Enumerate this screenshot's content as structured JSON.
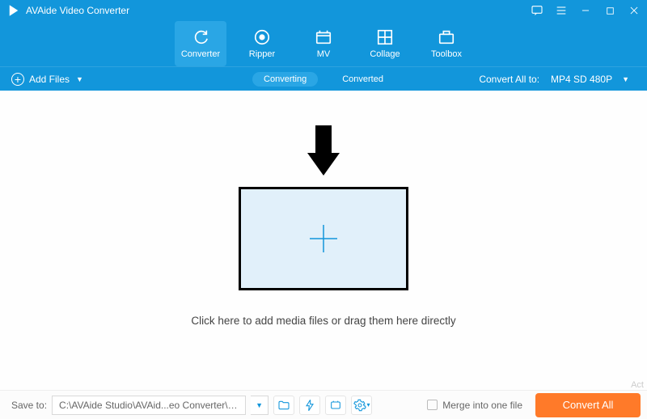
{
  "app": {
    "title": "AVAide Video Converter"
  },
  "nav": {
    "converter": "Converter",
    "ripper": "Ripper",
    "mv": "MV",
    "collage": "Collage",
    "toolbox": "Toolbox"
  },
  "subbar": {
    "add_files": "Add Files",
    "converting": "Converting",
    "converted": "Converted",
    "convert_all_to": "Convert All to:",
    "selected_format": "MP4 SD 480P"
  },
  "workspace": {
    "drop_text": "Click here to add media files or drag them here directly"
  },
  "bottombar": {
    "save_to_label": "Save to:",
    "path": "C:\\AVAide Studio\\AVAid...eo Converter\\Converted",
    "merge_label": "Merge into one file",
    "convert_label": "Convert All"
  },
  "watermark": "Act"
}
